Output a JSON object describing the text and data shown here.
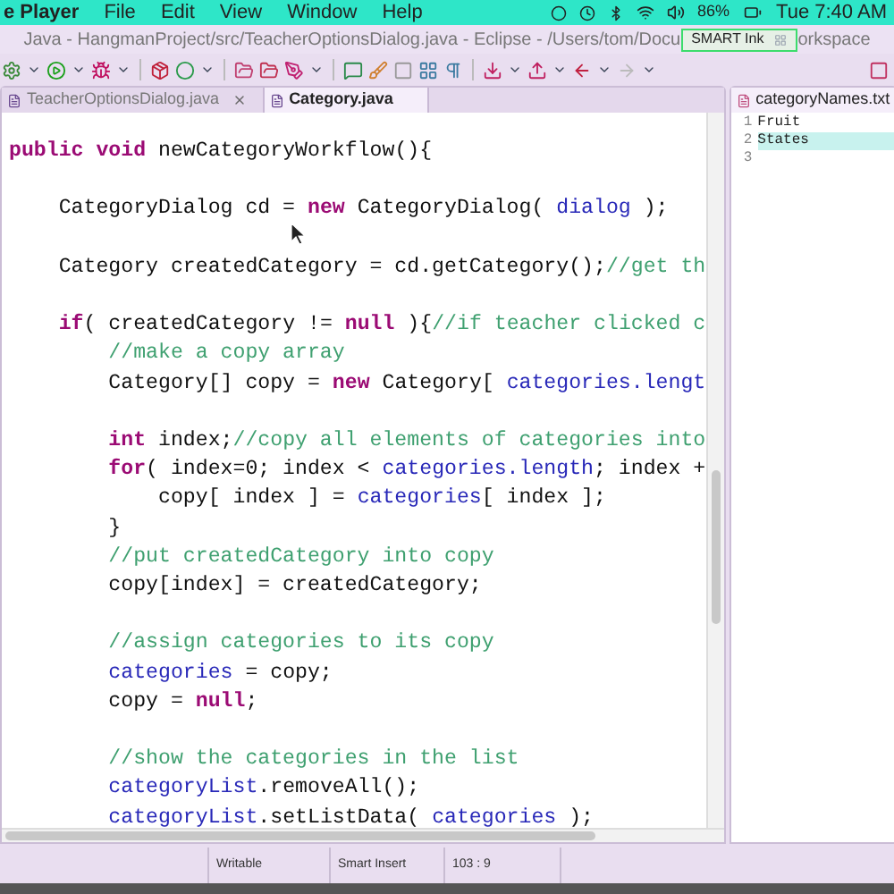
{
  "menu_bar": {
    "app": "e Player",
    "items": [
      "File",
      "Edit",
      "View",
      "Window",
      "Help"
    ],
    "battery": "86%",
    "clock": "Tue 7:40 AM"
  },
  "window": {
    "title_left": "Java - HangmanProject/src/TeacherOptionsDialog.java - Eclipse - /Users/tom/Docu",
    "title_right": "orkspace"
  },
  "smart_ink": {
    "label": "SMART Ink"
  },
  "editor_tabs": [
    {
      "label": "TeacherOptionsDialog.java",
      "selected": false
    },
    {
      "label": "Category.java",
      "selected": true
    }
  ],
  "code": [
    {
      "kind": "code",
      "tokens": [
        {
          "kind": "kw",
          "text": "public"
        },
        {
          "kind": "kw",
          "text": " void"
        },
        {
          "kind": "plain",
          "text": " newCategoryWorkflow(){"
        }
      ]
    },
    {
      "kind": "blank"
    },
    {
      "kind": "code",
      "tokens": [
        {
          "kind": "plain",
          "text": "    CategoryDialog cd = "
        },
        {
          "kind": "kw",
          "text": "new"
        },
        {
          "kind": "plain",
          "text": " CategoryDialog( "
        },
        {
          "kind": "field",
          "text": "dialog"
        },
        {
          "kind": "plain",
          "text": " );"
        }
      ]
    },
    {
      "kind": "blank"
    },
    {
      "kind": "code",
      "tokens": [
        {
          "kind": "plain",
          "text": "    Category createdCategory = cd.getCategory();"
        },
        {
          "kind": "comment",
          "text": "//get th"
        }
      ]
    },
    {
      "kind": "blank"
    },
    {
      "kind": "code",
      "tokens": [
        {
          "kind": "kw",
          "text": "    if"
        },
        {
          "kind": "plain",
          "text": "( createdCategory != "
        },
        {
          "kind": "kw",
          "text": "null"
        },
        {
          "kind": "plain",
          "text": " ){"
        },
        {
          "kind": "comment",
          "text": "//if teacher clicked c"
        }
      ]
    },
    {
      "kind": "code",
      "tokens": [
        {
          "kind": "comment",
          "text": "        //make a copy array"
        }
      ]
    },
    {
      "kind": "code",
      "tokens": [
        {
          "kind": "plain",
          "text": "        Category[] copy = "
        },
        {
          "kind": "kw",
          "text": "new"
        },
        {
          "kind": "plain",
          "text": " Category[ "
        },
        {
          "kind": "field",
          "text": "categories.lengt"
        }
      ]
    },
    {
      "kind": "blank"
    },
    {
      "kind": "code",
      "tokens": [
        {
          "kind": "kw",
          "text": "        int"
        },
        {
          "kind": "plain",
          "text": " index;"
        },
        {
          "kind": "comment",
          "text": "//copy all elements of categories into"
        }
      ]
    },
    {
      "kind": "code",
      "tokens": [
        {
          "kind": "kw",
          "text": "        for"
        },
        {
          "kind": "plain",
          "text": "( index=0; index < "
        },
        {
          "kind": "field",
          "text": "categories.length"
        },
        {
          "kind": "plain",
          "text": "; index +"
        }
      ]
    },
    {
      "kind": "code",
      "tokens": [
        {
          "kind": "plain",
          "text": "            copy[ index ] = "
        },
        {
          "kind": "field",
          "text": "categories"
        },
        {
          "kind": "plain",
          "text": "[ index ];"
        }
      ]
    },
    {
      "kind": "code",
      "tokens": [
        {
          "kind": "plain",
          "text": "        }"
        }
      ]
    },
    {
      "kind": "code",
      "tokens": [
        {
          "kind": "comment",
          "text": "        //put createdCategory into copy"
        }
      ]
    },
    {
      "kind": "code",
      "tokens": [
        {
          "kind": "plain",
          "text": "        copy[index] = createdCategory;"
        }
      ]
    },
    {
      "kind": "blank"
    },
    {
      "kind": "code",
      "tokens": [
        {
          "kind": "comment",
          "text": "        //assign categories to its copy"
        }
      ]
    },
    {
      "kind": "code",
      "tokens": [
        {
          "kind": "field",
          "text": "        categories"
        },
        {
          "kind": "plain",
          "text": " = copy;"
        }
      ]
    },
    {
      "kind": "code",
      "tokens": [
        {
          "kind": "plain",
          "text": "        copy = "
        },
        {
          "kind": "kw",
          "text": "null"
        },
        {
          "kind": "plain",
          "text": ";"
        }
      ]
    },
    {
      "kind": "blank"
    },
    {
      "kind": "code",
      "tokens": [
        {
          "kind": "comment",
          "text": "        //show the categories in the list"
        }
      ]
    },
    {
      "kind": "code",
      "tokens": [
        {
          "kind": "field",
          "text": "        categoryList"
        },
        {
          "kind": "plain",
          "text": ".removeAll();"
        }
      ]
    },
    {
      "kind": "code",
      "tokens": [
        {
          "kind": "field",
          "text": "        categoryList"
        },
        {
          "kind": "plain",
          "text": ".setListData( "
        },
        {
          "kind": "field",
          "text": "categories"
        },
        {
          "kind": "plain",
          "text": " );"
        }
      ]
    }
  ],
  "side_editor": {
    "tab": "categoryNames.txt",
    "lines": [
      {
        "number": "1",
        "text": "Fruit",
        "highlighted": false
      },
      {
        "number": "2",
        "text": "States",
        "highlighted": true
      },
      {
        "number": "3",
        "highlighted": false
      }
    ]
  },
  "status_bar": {
    "mode": "Writable",
    "insert": "Smart Insert",
    "position": "103 : 9"
  }
}
